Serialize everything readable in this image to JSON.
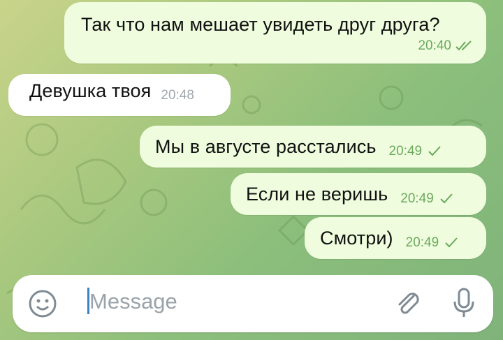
{
  "messages": [
    {
      "direction": "outgoing",
      "text": "Так что нам мешает увидеть друг друга?",
      "time": "20:40",
      "status": "read"
    },
    {
      "direction": "incoming",
      "text": "Девушка твоя",
      "time": "20:48"
    },
    {
      "direction": "outgoing",
      "text": "Мы в августе расстались",
      "time": "20:49",
      "status": "sent"
    },
    {
      "direction": "outgoing",
      "text": "Если не веришь",
      "time": "20:49",
      "status": "sent"
    },
    {
      "direction": "outgoing",
      "text": "Смотри)",
      "time": "20:49",
      "status": "sent"
    }
  ],
  "composer": {
    "placeholder": "Message",
    "icons": [
      "emoji-icon",
      "attach-icon",
      "microphone-icon"
    ]
  },
  "colors": {
    "outgoing_bubble": "#effdde",
    "incoming_bubble": "#ffffff",
    "check_color": "#6aa95c",
    "caret_color": "#3b82c4"
  }
}
